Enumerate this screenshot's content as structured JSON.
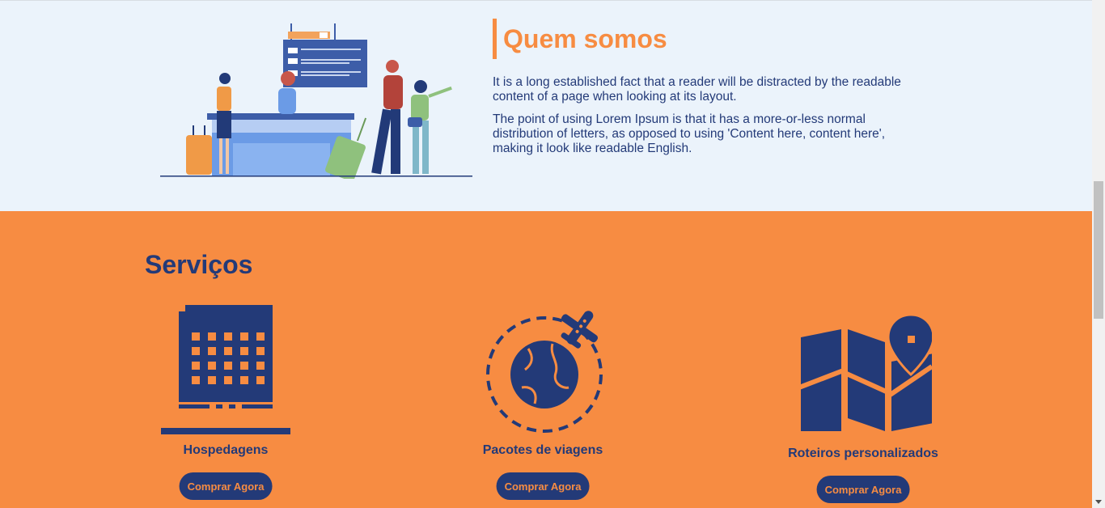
{
  "about": {
    "title": "Quem somos",
    "paragraphs": [
      "It is a long established fact that a reader will be distracted by the readable content of a page when looking at its layout.",
      "The point of using Lorem Ipsum is that it has a more-or-less normal distribution of letters, as opposed to using 'Content here, content here', making it look like readable English."
    ]
  },
  "services": {
    "title": "Serviços",
    "items": [
      {
        "label": "Hospedagens",
        "icon": "hotel-building-icon",
        "button": "Comprar Agora"
      },
      {
        "label": "Pacotes de viagens",
        "icon": "globe-airplane-icon",
        "button": "Comprar Agora"
      },
      {
        "label": "Roteiros personalizados",
        "icon": "map-pin-icon",
        "button": "Comprar Agora"
      }
    ]
  },
  "colors": {
    "accent": "#f78c42",
    "primary": "#233a78",
    "about_bg": "#ebf3fb"
  }
}
